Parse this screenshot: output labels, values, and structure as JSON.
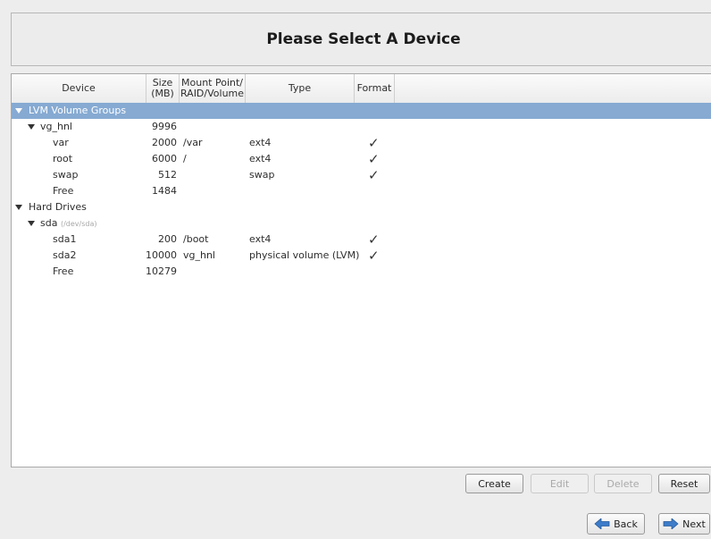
{
  "page": {
    "title": "Please Select A Device"
  },
  "columns": {
    "device": "Device",
    "size_line1": "Size",
    "size_line2": "(MB)",
    "mount_line1": "Mount Point/",
    "mount_line2": "RAID/Volume",
    "type": "Type",
    "format": "Format"
  },
  "rows": [
    {
      "name": "LVM Volume Groups",
      "size": "",
      "mount": "",
      "type": "",
      "format": ""
    },
    {
      "name": "vg_hnl",
      "size": "9996",
      "mount": "",
      "type": "",
      "format": ""
    },
    {
      "name": "var",
      "size": "2000",
      "mount": "/var",
      "type": "ext4",
      "format": "✓"
    },
    {
      "name": "root",
      "size": "6000",
      "mount": "/",
      "type": "ext4",
      "format": "✓"
    },
    {
      "name": "swap",
      "size": "512",
      "mount": "",
      "type": "swap",
      "format": "✓"
    },
    {
      "name": "Free",
      "size": "1484",
      "mount": "",
      "type": "",
      "format": ""
    },
    {
      "name": "Hard Drives",
      "size": "",
      "mount": "",
      "type": "",
      "format": ""
    },
    {
      "name": "sda",
      "hint": "(/dev/sda)",
      "size": "",
      "mount": "",
      "type": "",
      "format": ""
    },
    {
      "name": "sda1",
      "size": "200",
      "mount": "/boot",
      "type": "ext4",
      "format": "✓"
    },
    {
      "name": "sda2",
      "size": "10000",
      "mount": "vg_hnl",
      "type": "physical volume (LVM)",
      "format": "✓"
    },
    {
      "name": "Free",
      "size": "10279",
      "mount": "",
      "type": "",
      "format": ""
    }
  ],
  "buttons": {
    "create": "Create",
    "edit": "Edit",
    "delete": "Delete",
    "reset": "Reset",
    "back": "Back",
    "next": "Next"
  },
  "icons": {
    "back": "arrow-left-icon",
    "next": "arrow-right-icon",
    "expander": "triangle-down-icon"
  },
  "colors": {
    "selection": "#86aad2",
    "arrow": "#3d7cc9"
  }
}
